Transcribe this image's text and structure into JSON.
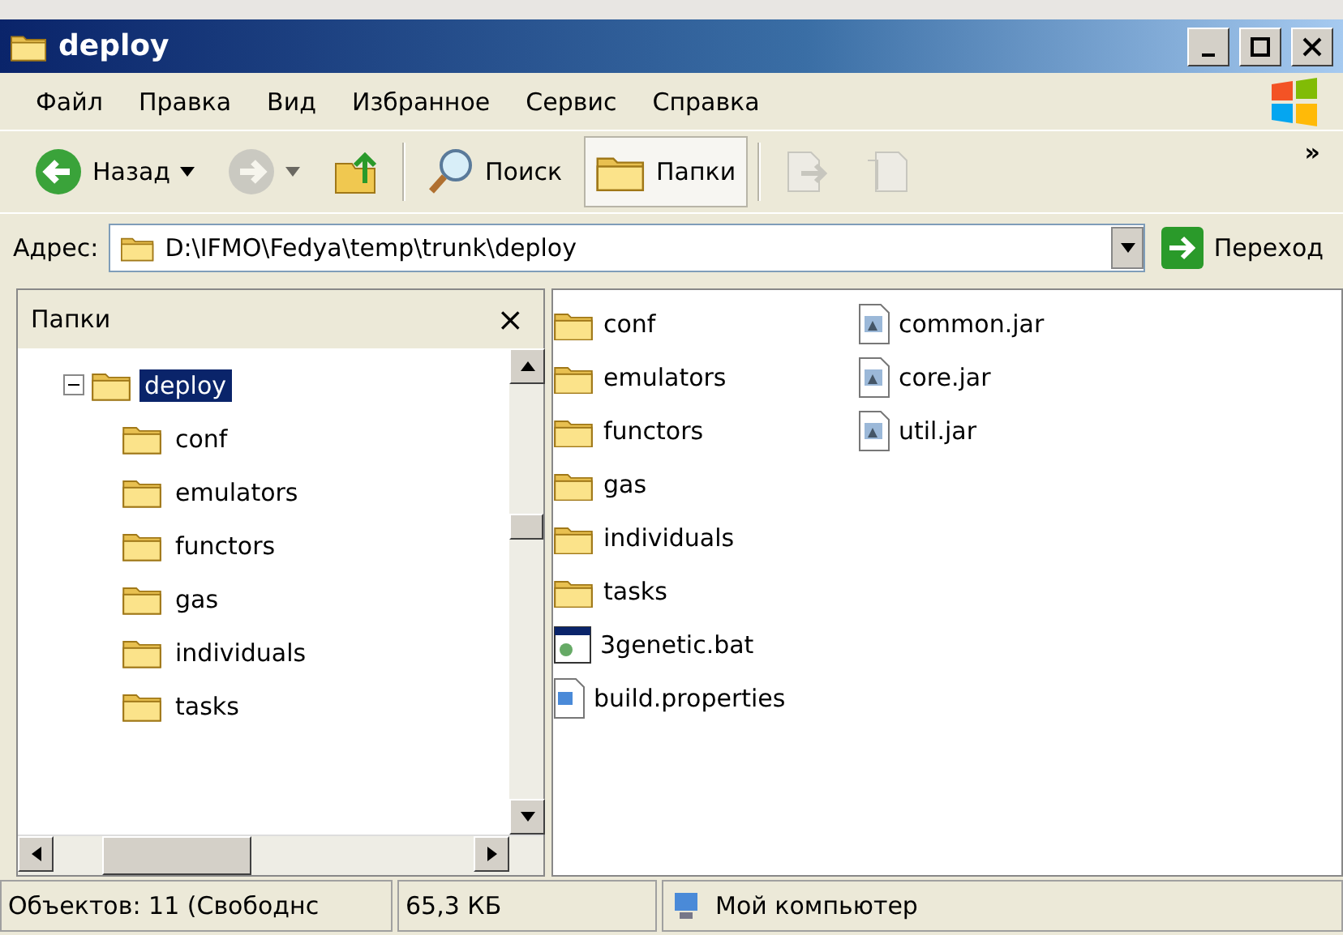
{
  "window": {
    "title": "deploy"
  },
  "menu": [
    "Файл",
    "Правка",
    "Вид",
    "Избранное",
    "Сервис",
    "Справка"
  ],
  "toolbar": [
    {
      "kind": "back",
      "label": "Назад",
      "selected": false,
      "disabled": false
    },
    {
      "kind": "forward",
      "selected": false,
      "disabled": true
    },
    {
      "kind": "up",
      "selected": false,
      "disabled": false
    },
    {
      "kind": "search",
      "label": "Поиск",
      "selected": false,
      "disabled": false
    },
    {
      "kind": "folders",
      "label": "Папки",
      "selected": true,
      "disabled": false
    },
    {
      "kind": "move",
      "selected": false,
      "disabled": true
    },
    {
      "kind": "copy",
      "selected": false,
      "disabled": true
    }
  ],
  "toolbar_more": "»",
  "address": {
    "label": "Адрес:",
    "value": "D:\\IFMO\\Fedya\\temp\\trunk\\deploy",
    "go": "Переход"
  },
  "folders_pane": {
    "title": "Папки",
    "close": "×",
    "tree": [
      {
        "label": "deploy",
        "selected": true,
        "expanded": true,
        "children": [
          {
            "label": "conf",
            "selected": false
          },
          {
            "label": "emulators",
            "selected": false
          },
          {
            "label": "functors",
            "selected": false
          },
          {
            "label": "gas",
            "selected": false
          },
          {
            "label": "individuals",
            "selected": false
          },
          {
            "label": "tasks",
            "selected": false
          }
        ]
      }
    ]
  },
  "files": [
    {
      "name": "conf",
      "kind": "folder",
      "selected": false
    },
    {
      "name": "emulators",
      "kind": "folder",
      "selected": false
    },
    {
      "name": "functors",
      "kind": "folder",
      "selected": false
    },
    {
      "name": "gas",
      "kind": "folder",
      "selected": false
    },
    {
      "name": "individuals",
      "kind": "folder",
      "selected": false
    },
    {
      "name": "tasks",
      "kind": "folder",
      "selected": false
    },
    {
      "name": "3genetic.bat",
      "kind": "bat",
      "selected": false
    },
    {
      "name": "build.properties",
      "kind": "properties",
      "selected": false
    },
    {
      "name": "common.jar",
      "kind": "jar",
      "selected": false
    },
    {
      "name": "core.jar",
      "kind": "jar",
      "selected": false
    },
    {
      "name": "util.jar",
      "kind": "jar",
      "selected": false
    }
  ],
  "status_bar": [
    "Объектов: 11 (Свободнс",
    "65,3 КБ",
    "Мой компьютер"
  ]
}
